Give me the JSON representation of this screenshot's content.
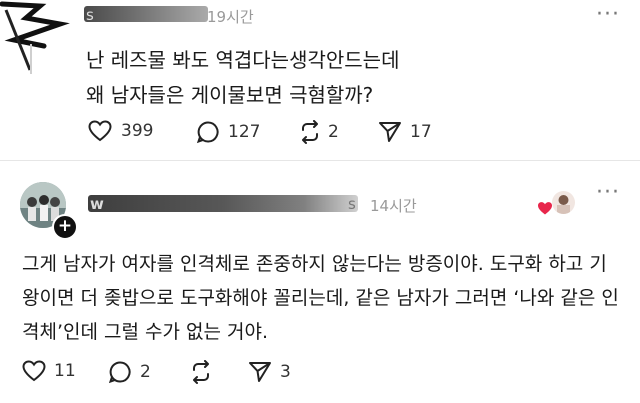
{
  "post1": {
    "username": "s",
    "time": "19시간",
    "body_line1": "난 레즈물 봐도 역겹다는생각안드는데",
    "body_line2": "왜 남자들은 게이물보면 극혐할까?",
    "likes": "399",
    "comments": "127",
    "reposts": "2",
    "shares": "17"
  },
  "post2": {
    "username": "w",
    "username_tail": "s",
    "time": "14시간",
    "body": "그게 남자가 여자를 인격체로 존중하지 않는다는 방증이야. 도구화 하고 기왕이면 더 좆밥으로 도구화해야 꼴리는데, 같은 남자가 그러면 ‘나와 같은 인격체’인데 그럴 수가 없는 거야.",
    "likes": "11",
    "comments": "2",
    "shares": "3"
  },
  "more_label": "···",
  "colors": {
    "heart": "#e8264b",
    "muted": "#9a9a9a",
    "text": "#1a1a1a"
  }
}
